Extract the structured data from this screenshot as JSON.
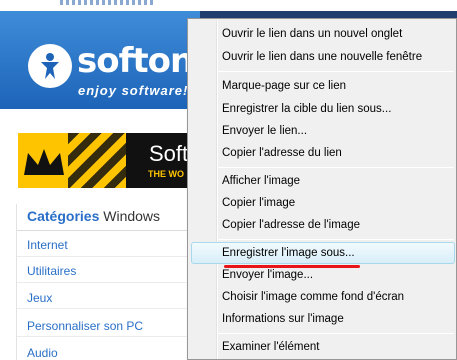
{
  "page": {
    "logo": {
      "word": "softonic",
      "tagline": "enjoy software!"
    },
    "banner": {
      "title": "Softo",
      "subtitle": "THE WO"
    },
    "categories": {
      "title_strong": "Catégories",
      "title_rest": "Windows",
      "items": [
        "Internet",
        "Utilitaires",
        "Jeux",
        "Personnaliser son PC",
        "Audio"
      ]
    }
  },
  "context_menu": {
    "items": [
      {
        "label": "Ouvrir le lien dans un nouvel onglet"
      },
      {
        "label": "Ouvrir le lien dans une nouvelle fenêtre"
      },
      {
        "label": "Marque-page sur ce lien"
      },
      {
        "label": "Enregistrer la cible du lien sous..."
      },
      {
        "label": "Envoyer le lien..."
      },
      {
        "label": "Copier l'adresse du lien"
      },
      {
        "label": "Afficher l'image"
      },
      {
        "label": "Copier l'image"
      },
      {
        "label": "Copier l'adresse de l'image"
      },
      {
        "label": "Enregistrer l'image sous..."
      },
      {
        "label": "Envoyer l'image..."
      },
      {
        "label": "Choisir l'image comme fond d'écran"
      },
      {
        "label": "Informations sur l'image"
      },
      {
        "label": "Examiner l'élément"
      }
    ],
    "highlighted_item": "Enregistrer l'image sous...",
    "colors": {
      "highlight_border": "#a8d8eb",
      "annotation_red": "#e8161a",
      "brand_blue": "#1d64b8"
    }
  }
}
